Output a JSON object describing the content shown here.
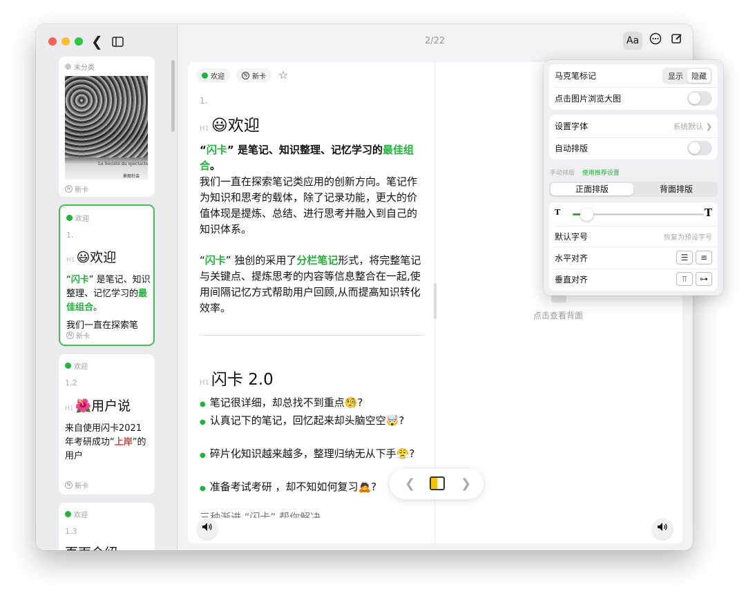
{
  "toolbar": {
    "back_icon": "chevron-left-icon",
    "sidebar_toggle_icon": "sidebar-icon",
    "page_indicator": "2/22",
    "font_button": "Aa",
    "more_icon": "ellipsis-circle-icon",
    "edit_icon": "compose-icon"
  },
  "sidebar": {
    "cards": [
      {
        "tag": "未分类",
        "footer": "新卡",
        "image_caption": "La Société du spectacle",
        "image_caption_bottom": "景观社会"
      },
      {
        "tag": "欢迎",
        "number": "1.",
        "heading": "😃欢迎",
        "text_prefix": "“",
        "text_hl1": "闪卡",
        "text_mid": "” 是笔记、知识整理、记忆学习的",
        "text_hl2": "最佳组合",
        "text_end": "。",
        "text_more": "我们一直在探索笔",
        "footer": "新卡"
      },
      {
        "tag": "欢迎",
        "number": "1.2",
        "heading": "🌺用户说",
        "text_a": "来自使用闪卡2021年考研成功“",
        "text_hl": "上岸",
        "text_b": "”的用户",
        "footer": "新卡"
      },
      {
        "tag": "欢迎",
        "number": "1.3",
        "heading": "页面介绍"
      }
    ]
  },
  "editor": {
    "tag_label": "欢迎",
    "card_type": "新卡",
    "number": "1.",
    "heading": "😃欢迎",
    "p1_a": "“",
    "p1_hl1": "闪卡",
    "p1_b": "” 是笔记、知识整理、记忆学习的",
    "p1_hl2": "最佳组合",
    "p1_c": "。",
    "p2": "我们一直在探索笔记类应用的创新方向。笔记作为知识和思考的载体，除了记录功能，更大的价值体现是提炼、总结、进行思考并融入到自己的知识体系。",
    "p3_a": "“",
    "p3_hl1": "闪卡",
    "p3_b": "” 独创的采用了",
    "p3_hl2": "分栏笔记",
    "p3_c": "形式，将完整笔记与关键点、提炼思考的内容等信息整合在一起,使用间隔记忆方式帮助用户回顾,从而提高知识转化效率。",
    "h2": "闪卡 2.0",
    "bullets": [
      "笔记很详细，却总找不到重点🧐?",
      "认真记下的笔记，回忆起来却头脑空空🤯?",
      "碎片化知识越来越多，整理归纳无从下手😤?",
      "准备考试考研 ，却不知如何复习🙇?"
    ],
    "cut_line": "三种渐进 “闪卡” 帮你解决"
  },
  "back_side": {
    "hint": "点击查看背面"
  },
  "bottom_nav": {
    "prev_icon": "chevron-left-icon",
    "view_icon": "split-view-icon",
    "next_icon": "chevron-right-icon",
    "speaker_icon": "speaker-icon"
  },
  "popover": {
    "marker_label": "马克笔标记",
    "marker_show": "显示",
    "marker_hide": "隐藏",
    "image_preview_label": "点击图片浏览大图",
    "font_label": "设置字体",
    "font_value": "系统默认",
    "auto_layout_label": "自动排版",
    "manual_layout_label": "手动排版",
    "recommended_label": "使用推荐设置",
    "front_layout": "正面排版",
    "back_layout": "背面排版",
    "font_size_small": "T",
    "font_size_large": "T",
    "font_size_level": 0.08,
    "default_size_label": "默认字号",
    "reset_size_label": "恢复为预设字号",
    "h_align_label": "水平对齐",
    "v_align_label": "垂直对齐"
  },
  "colors": {
    "accent": "#22b33a",
    "highlight_red": "#e04040",
    "traffic_red": "#ff5f57",
    "traffic_yellow": "#febc2e",
    "traffic_green": "#28c840"
  }
}
